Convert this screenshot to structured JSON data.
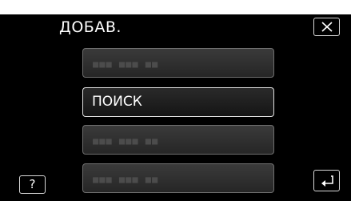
{
  "header": {
    "title": "ДОБАВ.",
    "close_icon": "close-icon"
  },
  "list": {
    "items": [
      {
        "label": "■■■ ■■■ ■■",
        "state": "placeholder"
      },
      {
        "label": "ПОИСК",
        "state": "selected"
      },
      {
        "label": "■■■ ■■■ ■■",
        "state": "placeholder"
      },
      {
        "label": "■■■ ■■■ ■■",
        "state": "placeholder"
      }
    ]
  },
  "footer": {
    "help_label": "?",
    "back_icon": "back-arrow-icon"
  },
  "colors": {
    "background": "#000000",
    "button_border": "#6f6f6f",
    "selected_border": "#e0e0e0",
    "text": "#ffffff"
  }
}
